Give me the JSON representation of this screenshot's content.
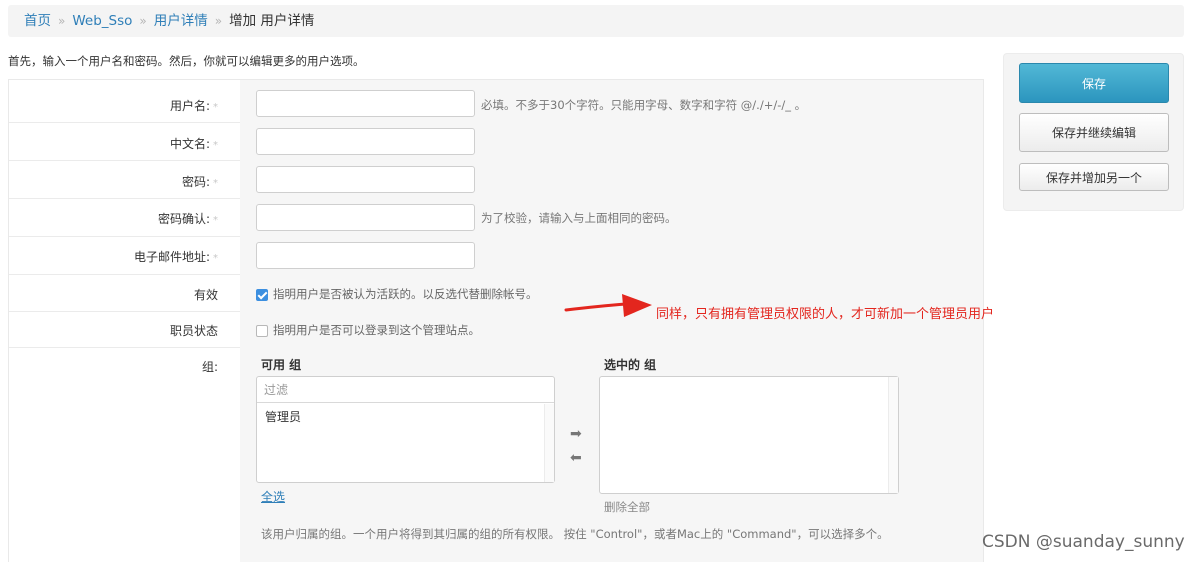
{
  "breadcrumb": {
    "home": "首页",
    "app": "Web_Sso",
    "model": "用户详情",
    "current": "增加 用户详情",
    "separator": "»"
  },
  "intro": "首先，输入一个用户名和密码。然后，你就可以编辑更多的用户选项。",
  "fields": {
    "username": {
      "label": "用户名:",
      "required": "*",
      "help": "必填。不多于30个字符。只能用字母、数字和字符 @/./+/-/_ 。"
    },
    "chinese_name": {
      "label": "中文名:",
      "required": "*"
    },
    "password": {
      "label": "密码:",
      "required": "*"
    },
    "password_confirm": {
      "label": "密码确认:",
      "required": "*",
      "help": "为了校验，请输入与上面相同的密码。"
    },
    "email": {
      "label": "电子邮件地址:",
      "required": "*"
    },
    "active": {
      "label": "有效",
      "checked": true,
      "help": "指明用户是否被认为活跃的。以反选代替删除帐号。"
    },
    "staff": {
      "label": "职员状态",
      "checked": false,
      "help": "指明用户是否可以登录到这个管理站点。"
    },
    "groups": {
      "label": "组:",
      "available_title": "可用 组",
      "filter_placeholder": "过滤",
      "available_options": [
        "管理员"
      ],
      "select_all": "全选",
      "chosen_title": "选中的 组",
      "remove_all": "删除全部",
      "help": "该用户归属的组。一个用户将得到其归属的组的所有权限。 按住 \"Control\"，或者Mac上的 \"Command\"，可以选择多个。"
    }
  },
  "actions": {
    "save": "保存",
    "save_continue": "保存并继续编辑",
    "save_add_another": "保存并增加另一个"
  },
  "annotation": "同样，只有拥有管理员权限的人，才可新加一个管理员用户",
  "watermark": "CSDN @suanday_sunny",
  "colors": {
    "accent": "#2f7fb8",
    "annotation": "#e3261e",
    "primary_button": "#3ba6cb",
    "checkbox": "#3c8fe0"
  }
}
